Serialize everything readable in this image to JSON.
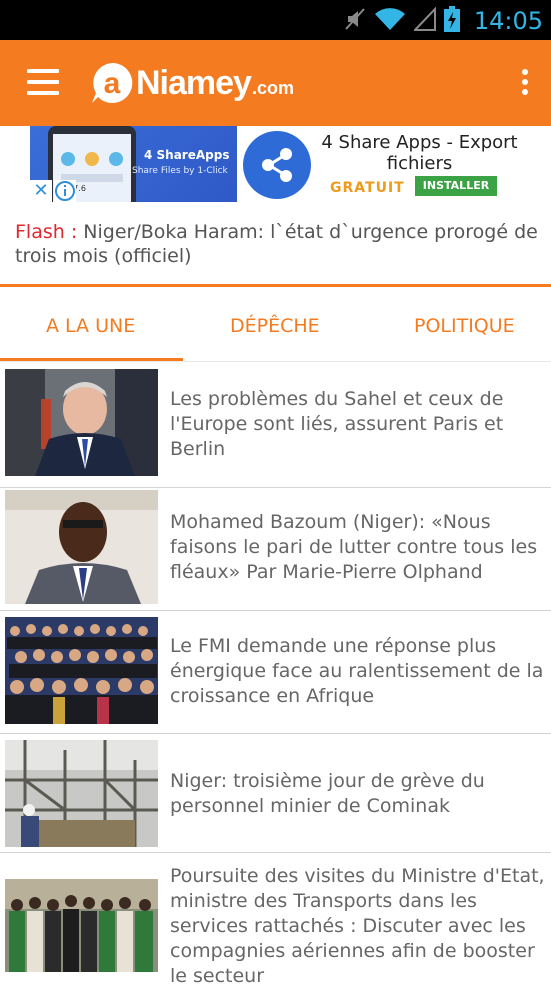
{
  "status_bar": {
    "time": "14:05",
    "icons": [
      "mute-icon",
      "wifi-icon",
      "signal-icon",
      "battery-charging-icon"
    ],
    "time_color": "#33b5e5"
  },
  "app_bar": {
    "logo_name": "Niamey",
    "logo_suffix": ".com",
    "logo_icon": "niamey-logo-icon",
    "background": "#f47b20"
  },
  "ad": {
    "left_title": "4 ShareApps",
    "left_subtitle": "Share Files by 1-Click",
    "phone_readout": "247.6",
    "title": "4 Share Apps - Export fichiers",
    "price": "GRATUIT",
    "install_label": "INSTALLER",
    "close_symbol": "✕"
  },
  "flash": {
    "label": "Flash",
    "separator": " : ",
    "text": "Niger/Boka Haram: l`état d`urgence prorogé de trois mois (officiel)"
  },
  "tabs": [
    {
      "label": "A LA UNE",
      "selected": true
    },
    {
      "label": "DÉPÊCHE",
      "selected": false
    },
    {
      "label": "POLITIQUE",
      "selected": false
    }
  ],
  "articles": [
    {
      "title": "Les problèmes du Sahel et ceux de l'Europe sont liés, assurent Paris et Berlin"
    },
    {
      "title": "Mohamed Bazoum (Niger): «Nous faisons le pari de lutter contre tous les fléaux» Par Marie-Pierre Olphand"
    },
    {
      "title": "Le FMI demande une réponse plus énergique face au ralentissement de la croissance en Afrique"
    },
    {
      "title": "Niger: troisième jour de grève du personnel minier de Cominak"
    },
    {
      "title": "Poursuite des visites du Ministre d'Etat, ministre des Transports dans les services rattachés : Discuter avec les compagnies aériennes afin de booster le secteur"
    }
  ],
  "colors": {
    "accent": "#f47b20",
    "flash_red": "#e1262d",
    "text_gray": "#666666"
  }
}
